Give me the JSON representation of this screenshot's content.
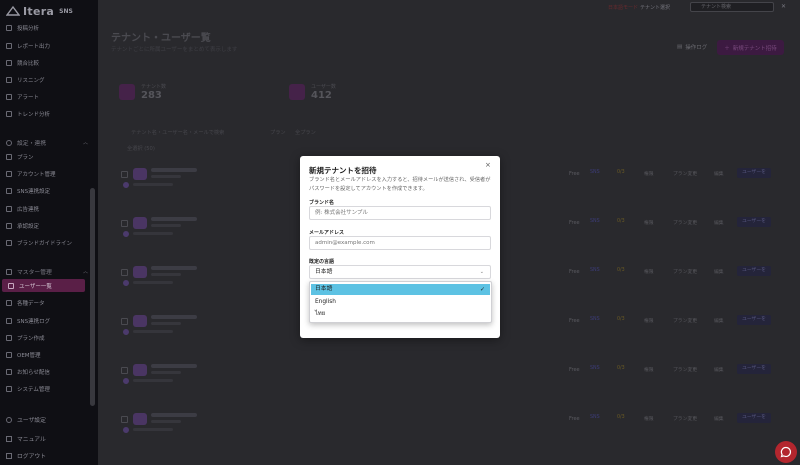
{
  "app": {
    "logo": "Itera",
    "logo_suffix": "SNS"
  },
  "sidebar": {
    "items_top": [
      {
        "label": "投稿分析"
      },
      {
        "label": "レポート出力"
      },
      {
        "label": "競合比較"
      },
      {
        "label": "リスニング"
      },
      {
        "label": "アラート"
      },
      {
        "label": "トレンド分析"
      }
    ],
    "section_settings": "設定・連携",
    "items_settings": [
      {
        "label": "プラン"
      },
      {
        "label": "アカウント管理"
      },
      {
        "label": "SNS連携設定"
      },
      {
        "label": "広告連携"
      },
      {
        "label": "承認設定"
      },
      {
        "label": "ブランドガイドライン"
      }
    ],
    "section_master": "マスター管理",
    "items_master": [
      {
        "label": "ユーザー一覧",
        "active": true
      },
      {
        "label": "各種データ"
      },
      {
        "label": "SNS連携ログ"
      },
      {
        "label": "プラン作成"
      },
      {
        "label": "OEM管理"
      },
      {
        "label": "お知らせ配信"
      },
      {
        "label": "システム管理"
      }
    ],
    "bottom": [
      {
        "label": "ユーザ設定"
      },
      {
        "label": "マニュアル"
      },
      {
        "label": "ログアウト"
      }
    ]
  },
  "topbar": {
    "link1": "日本語モード",
    "link2": "テナント選択",
    "search_placeholder": "テナント検索"
  },
  "header": {
    "title": "テナント・ユーザー覧",
    "subtitle": "テナントごとに所属ユーザーをまとめて表示します",
    "log_button": "操作ログ",
    "invite_button": "新規テナント招待"
  },
  "stats": [
    {
      "label": "テナント数",
      "value": "283"
    },
    {
      "label": "ユーザー数",
      "value": "412"
    }
  ],
  "filters": {
    "search_placeholder": "テナント名・ユーザー名・メールで検索",
    "plan_label": "プラン",
    "plan_value": "全プラン",
    "select_all": "全選択 (50)"
  },
  "table": {
    "plan": "Free",
    "tag1": "SNS",
    "tag2": "0/3",
    "actions": [
      "権限",
      "プラン変更",
      "編集"
    ],
    "user_button": "ユーザーを"
  },
  "modal": {
    "title": "新規テナントを招待",
    "close": "×",
    "description": "ブランド名とメールアドレスを入力すると、招待メールが送信され、受信者がパスワードを設定してアカウントを作成できます。",
    "brand_label": "ブランド名",
    "brand_placeholder": "例: 株式会社サンプル",
    "email_label": "メールアドレス",
    "email_placeholder": "admin@example.com",
    "lang_label": "既定の言語",
    "lang_value": "日本語",
    "options": [
      {
        "label": "日本語",
        "selected": true
      },
      {
        "label": "English",
        "selected": false
      },
      {
        "label": "ไทย",
        "selected": false
      }
    ]
  },
  "colors": {
    "accent": "#b3262e",
    "selected_option": "#5dc2e3",
    "sidebar_bg": "#0f0f14"
  }
}
